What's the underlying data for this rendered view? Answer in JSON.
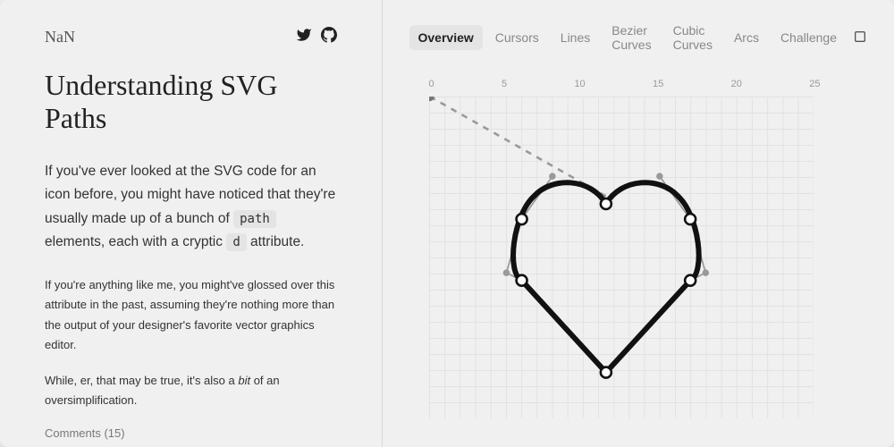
{
  "logo": "NaN",
  "title": "Understanding SVG Paths",
  "para1_pre": "If you've ever looked at the SVG code for an icon before, you might have noticed that they're usually made up of a bunch of ",
  "para1_code1": "path",
  "para1_mid": " elements, each with a cryptic ",
  "para1_code2": "d",
  "para1_post": " attribute.",
  "para2": "If you're anything like me, you might've glossed over this attribute in the past, assuming they're nothing more than the output of your designer's favorite vector graphics editor.",
  "para3_pre": "While, er, that may be true, it's also a ",
  "para3_em": "bit",
  "para3_post": " of an oversimplification.",
  "comments": "Comments (15)",
  "tabs": [
    "Overview",
    "Cursors",
    "Lines",
    "Bezier Curves",
    "Cubic Curves",
    "Arcs",
    "Challenge"
  ],
  "activeTab": 0,
  "axis": [
    "0",
    "5",
    "10",
    "15",
    "20",
    "25"
  ]
}
